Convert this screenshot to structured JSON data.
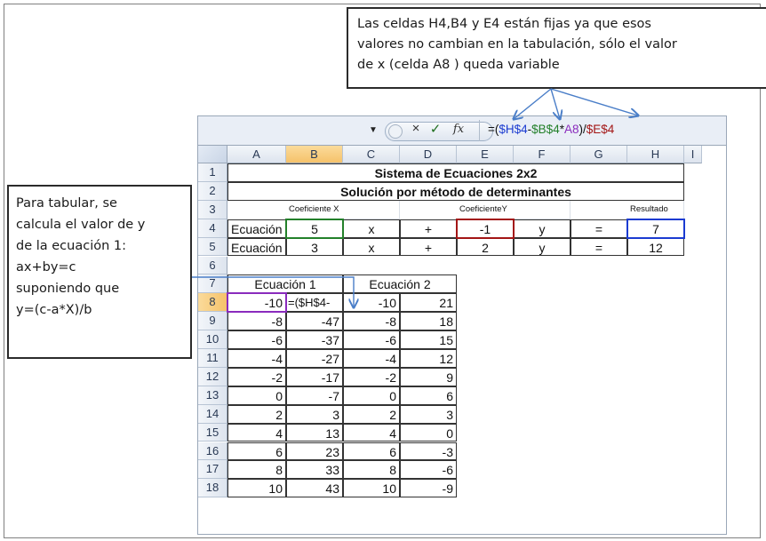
{
  "callout_top": {
    "lines": [
      "Las celdas H4,B4 y E4 están fijas  ya que esos",
      "valores no cambian en la tabulación, sólo el valor",
      "de x (celda A8 ) queda variable"
    ]
  },
  "callout_left": {
    "lines": [
      "Para tabular, se",
      "calcula el valor de y",
      "de la ecuación 1:",
      "ax+by=c",
      "suponiendo que",
      "y=(c-a*X)/b"
    ]
  },
  "formula_bar": {
    "formula_parts": [
      "=(",
      "$H$4",
      "-",
      "$B$4",
      "*",
      "A8",
      ")/",
      "$E$4"
    ],
    "cancel_icon": "×",
    "enter_icon": "✓",
    "fx_label": "fx"
  },
  "columns": [
    "A",
    "B",
    "C",
    "D",
    "E",
    "F",
    "G",
    "H",
    "I"
  ],
  "rows": [
    "1",
    "2",
    "3",
    "4",
    "5",
    "6",
    "7",
    "8",
    "9",
    "10",
    "11",
    "12",
    "13",
    "14",
    "15",
    "16",
    "17",
    "18"
  ],
  "sheet": {
    "title": "Sistema de Ecuaciones 2x2",
    "subtitle": "Solución por método de determinantes",
    "coef_x_label": "Coeficiente X",
    "coef_y_label": "CoeficienteY",
    "result_label": "Resultado",
    "eq1": {
      "label": "Ecuación 1",
      "a": "5",
      "x": "x",
      "plus": "+",
      "b": "-1",
      "y": "y",
      "eq": "=",
      "c": "7"
    },
    "eq2": {
      "label": "Ecuación 2",
      "a": "3",
      "x": "x",
      "plus": "+",
      "b": "2",
      "y": "y",
      "eq": "=",
      "c": "12"
    },
    "table_header_1": "Ecuación 1",
    "table_header_2": "Ecuación 2",
    "editing_text": "=($H$4-",
    "table": [
      [
        "-10",
        "=($H$4-",
        "-10",
        "21"
      ],
      [
        "-8",
        "-47",
        "-8",
        "18"
      ],
      [
        "-6",
        "-37",
        "-6",
        "15"
      ],
      [
        "-4",
        "-27",
        "-4",
        "12"
      ],
      [
        "-2",
        "-17",
        "-2",
        "9"
      ],
      [
        "0",
        "-7",
        "0",
        "6"
      ],
      [
        "2",
        "3",
        "2",
        "3"
      ],
      [
        "4",
        "13",
        "4",
        "0"
      ],
      [
        "6",
        "23",
        "6",
        "-3"
      ],
      [
        "8",
        "33",
        "8",
        "-6"
      ],
      [
        "10",
        "43",
        "10",
        "-9"
      ]
    ]
  },
  "colors": {
    "ref_h": "#1b3bd1",
    "ref_b": "#23802a",
    "ref_a": "#8a2bbd",
    "ref_e": "#a31515",
    "selected_header": "#f5c26a"
  }
}
